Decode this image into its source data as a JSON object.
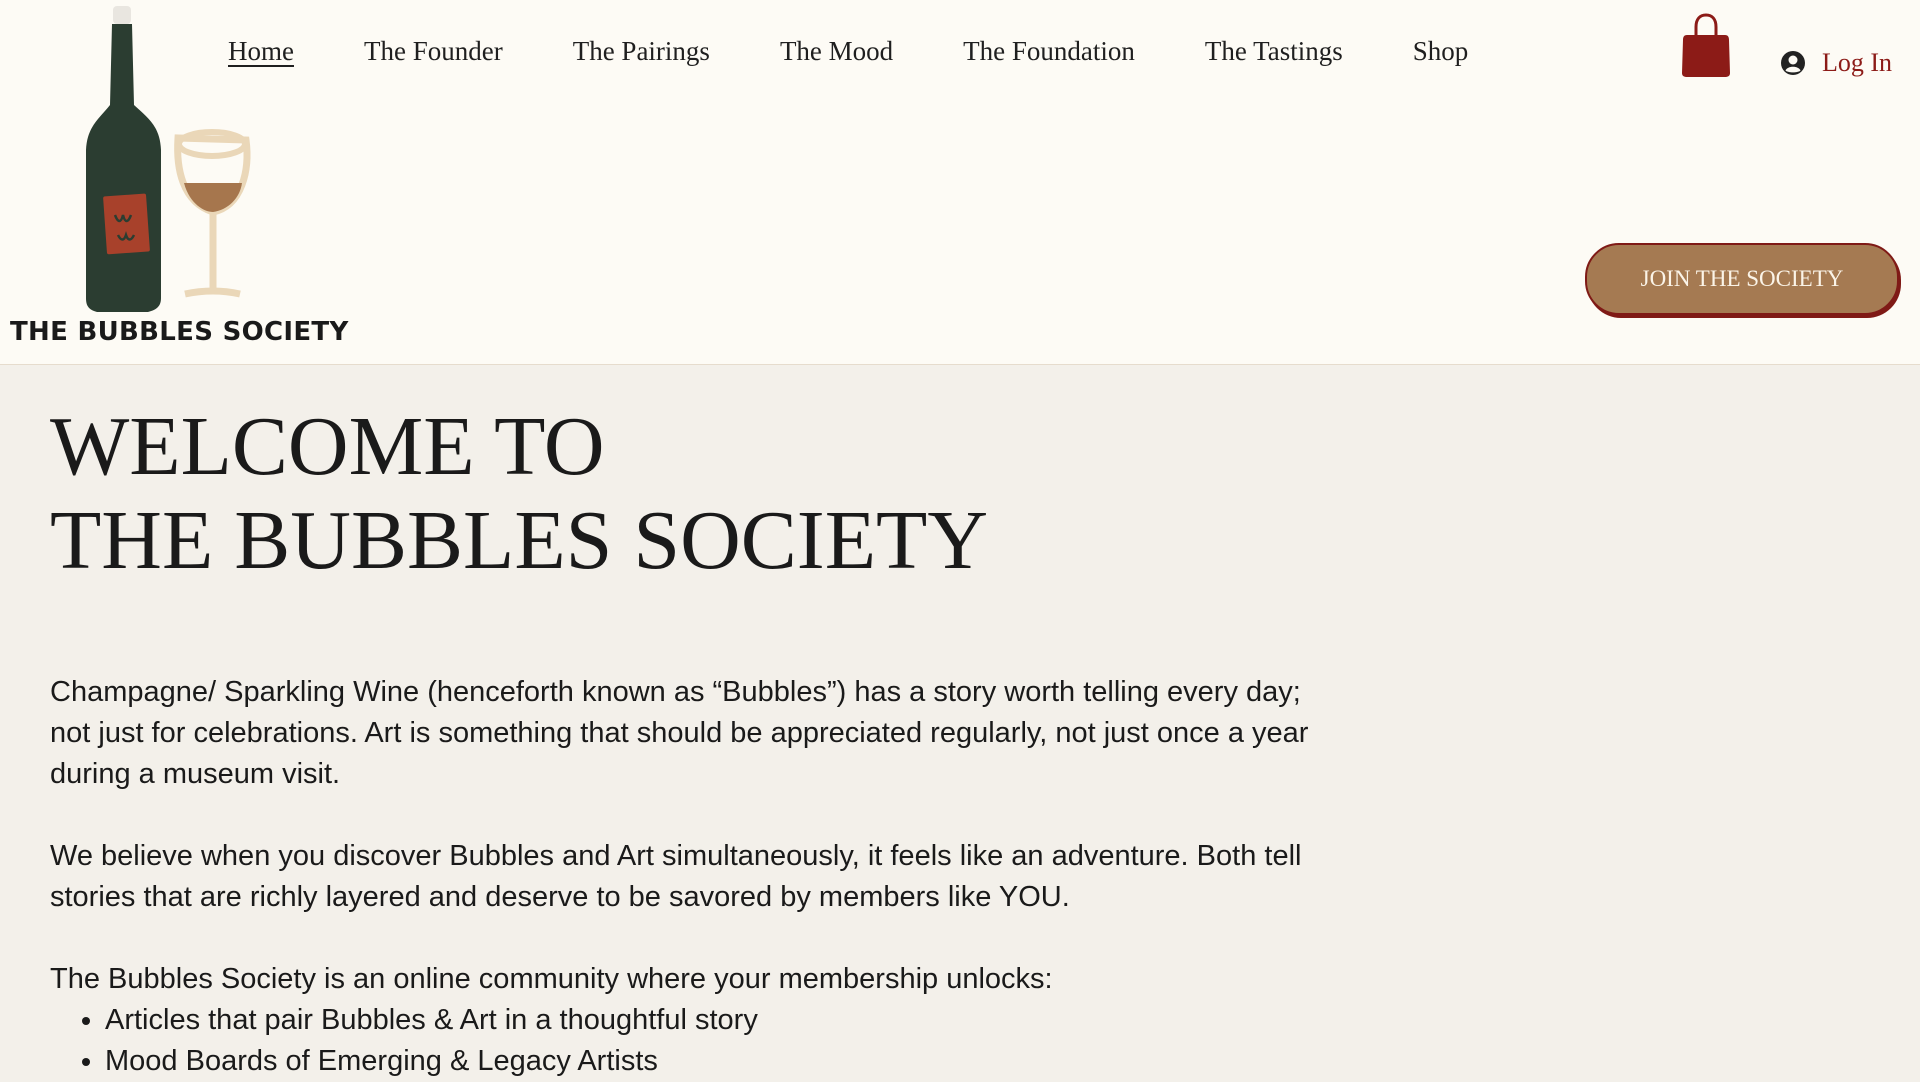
{
  "logo": {
    "text": "THE BUBBLES SOCIETY",
    "icon": "wine-bottle-and-glass-logo"
  },
  "nav": [
    {
      "label": "Home",
      "active": true
    },
    {
      "label": "The Founder"
    },
    {
      "label": "The Pairings"
    },
    {
      "label": "The Mood"
    },
    {
      "label": "The Foundation"
    },
    {
      "label": "The Tastings"
    },
    {
      "label": "Shop"
    }
  ],
  "cart": {
    "icon": "shopping-bag-icon",
    "color": "#8c1b17"
  },
  "login": {
    "label": "Log In",
    "icon": "user-avatar-icon"
  },
  "join_button": {
    "label": "JOIN THE SOCIETY",
    "color": "#a57a52"
  },
  "main": {
    "heading_line1": "WELCOME TO",
    "heading_line2": "THE BUBBLES SOCIETY",
    "paragraph1": "Champagne/ Sparkling Wine (henceforth known as “Bubbles”) has a story worth telling every day; not just for celebrations. Art is something that should be appreciated regularly, not just once a year during a museum visit.",
    "paragraph2": "We believe when you discover Bubbles and Art simultaneously, it feels like an adventure. Both tell stories that are richly layered and deserve to be savored by members like YOU.",
    "paragraph3": "The Bubbles Society is an online community where your membership unlocks:",
    "bullets": [
      "Articles that pair Bubbles & Art in a thoughtful story",
      "Mood Boards of Emerging & Legacy Artists"
    ]
  }
}
